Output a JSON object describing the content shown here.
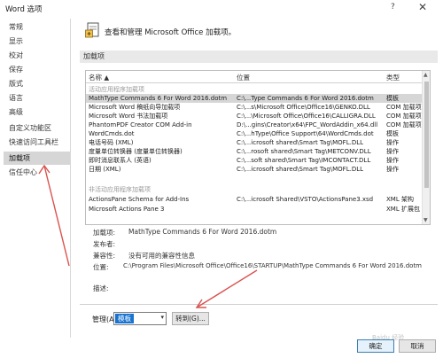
{
  "window": {
    "title": "Word 选项",
    "help": "?",
    "close": "✕"
  },
  "sidebar": {
    "items": [
      {
        "label": "常规"
      },
      {
        "label": "显示"
      },
      {
        "label": "校对"
      },
      {
        "label": "保存"
      },
      {
        "label": "版式"
      },
      {
        "label": "语言"
      },
      {
        "label": "高级"
      },
      {
        "label": "自定义功能区"
      },
      {
        "label": "快速访问工具栏"
      },
      {
        "label": "加载项"
      },
      {
        "label": "信任中心"
      }
    ],
    "active_index": 9
  },
  "main": {
    "header": "查看和管理 Microsoft Office 加载项。",
    "section_title": "加载项"
  },
  "table": {
    "columns": [
      "名称 ▲",
      "位置",
      "类型"
    ],
    "active_group": "活动应用程序加载项",
    "inactive_group": "非活动应用程序加载项",
    "active_rows": [
      {
        "name": "MathType Commands 6 For Word 2016.dotm",
        "location": "C:\\...Type Commands 6 For Word 2016.dotm",
        "type": "模板"
      },
      {
        "name": "Microsoft Word 稿纸向导加载项",
        "location": "C:\\...s\\Microsoft Office\\Office16\\GENKO.DLL",
        "type": "COM 加载项"
      },
      {
        "name": "Microsoft Word 书法加载项",
        "location": "C:\\...\\Microsoft Office\\Office16\\CALLIGRA.DLL",
        "type": "COM 加载项"
      },
      {
        "name": "PhantomPDF Creator COM Add-in",
        "location": "D:\\...gins\\Creator\\x64\\FPC_WordAddin_x64.dll",
        "type": "COM 加载项"
      },
      {
        "name": "WordCmds.dot",
        "location": "C:\\...hType\\Office Support\\64\\WordCmds.dot",
        "type": "模板"
      },
      {
        "name": "电话号码 (XML)",
        "location": "C:\\...icrosoft shared\\Smart Tag\\MOFL.DLL",
        "type": "操作"
      },
      {
        "name": "度量单位转换器 (度量单位转换器)",
        "location": "C:\\...rosoft shared\\Smart Tag\\METCONV.DLL",
        "type": "操作"
      },
      {
        "name": "即时消息联系人 (英语)",
        "location": "C:\\...soft shared\\Smart Tag\\IMCONTACT.DLL",
        "type": "操作"
      },
      {
        "name": "日期 (XML)",
        "location": "C:\\...icrosoft shared\\Smart Tag\\MOFL.DLL",
        "type": "操作"
      }
    ],
    "inactive_rows": [
      {
        "name": "ActionsPane Schema for Add-Ins",
        "location": "C:\\...icrosoft Shared\\VSTO\\ActionsPane3.xsd",
        "type": "XML 架构"
      },
      {
        "name": "Microsoft Actions Pane 3",
        "location": "",
        "type": "XML 扩展包"
      }
    ]
  },
  "details": {
    "addin_label": "加载项:",
    "addin_value": "MathType Commands 6 For Word 2016.dotm",
    "publisher_label": "发布者:",
    "publisher_value": "",
    "compat_label": "兼容性:",
    "compat_value": "没有可用的兼容性信息",
    "location_label": "位置:",
    "location_value": "C:\\Program Files\\Microsoft Office\\Office16\\STARTUP\\MathType Commands 6 For Word 2016.dotm",
    "description_label": "描述:"
  },
  "footer": {
    "manage_label": "管理(A):",
    "manage_value": "模板",
    "go_label": "转到(G)...",
    "ok_label": "确定",
    "cancel_label": "取消"
  },
  "watermark": "Baidu 经验",
  "colors": {
    "annotation_arrow": "#d9534f",
    "selected_bg": "#d6d6d6",
    "select_highlight": "#1874d0",
    "section_bg": "#e9e9e9"
  }
}
